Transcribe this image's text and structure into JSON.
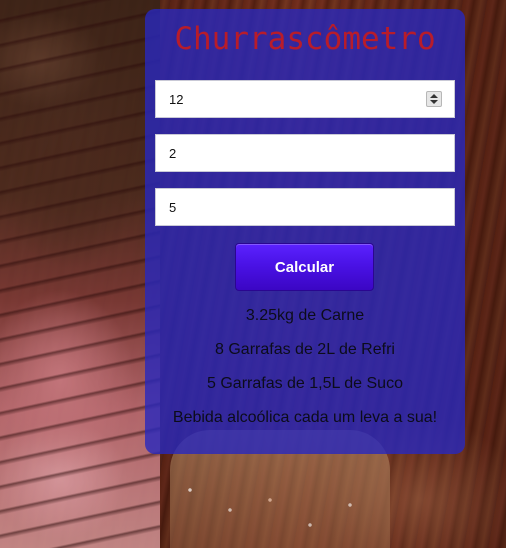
{
  "app": {
    "title": "Churrascômetro"
  },
  "form": {
    "adults_value": "12",
    "children_value": "2",
    "duration_value": "5",
    "calculate_label": "Calcular"
  },
  "results": {
    "meat": "3.25kg de Carne",
    "soda": "8 Garrafas de 2L de Refri",
    "juice": "5 Garrafas de 1,5L de Suco",
    "alcohol": "Bebida alcoólica cada um leva a sua!"
  },
  "colors": {
    "panel": "#2828be",
    "title": "#b81c2a",
    "button": "#4a12e6"
  },
  "icons": {
    "spinner": "number-spinner-icon"
  }
}
